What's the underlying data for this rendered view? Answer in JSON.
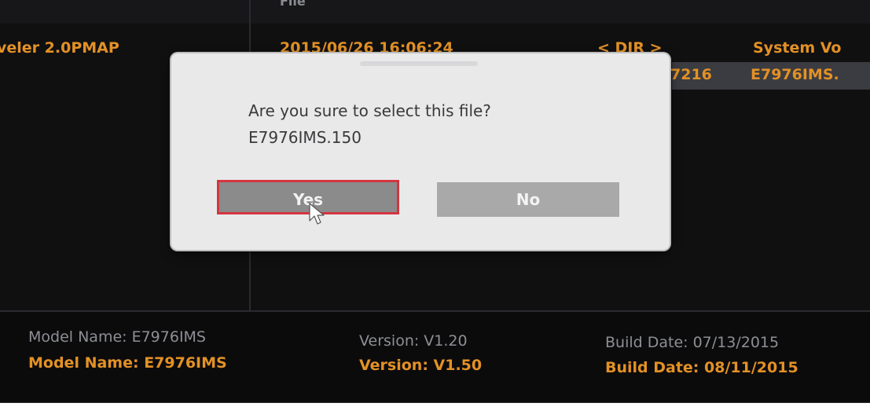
{
  "header": {
    "partial_column_title": "File"
  },
  "file_list": {
    "rows": [
      {
        "name": "veler 2.0PMAP",
        "date": "2015/06/26 16:06:24",
        "size": "< DIR >",
        "volume": "System Vo"
      }
    ],
    "selected_row": {
      "size_tail": "7216",
      "name": "E7976IMS."
    }
  },
  "dialog": {
    "question": "Are you sure to select this file?",
    "filename": "E7976IMS.150",
    "yes_label": "Yes",
    "no_label": "No"
  },
  "info": {
    "current": {
      "model": "Model Name: E7976IMS",
      "version": "Version: V1.20",
      "build": "Build Date: 07/13/2015"
    },
    "new": {
      "model": "Model Name: E7976IMS",
      "version": "Version: V1.50",
      "build": "Build Date: 08/11/2015"
    }
  },
  "colors": {
    "accent": "#e39125",
    "background": "#101011",
    "highlight_border": "#d3353f"
  }
}
